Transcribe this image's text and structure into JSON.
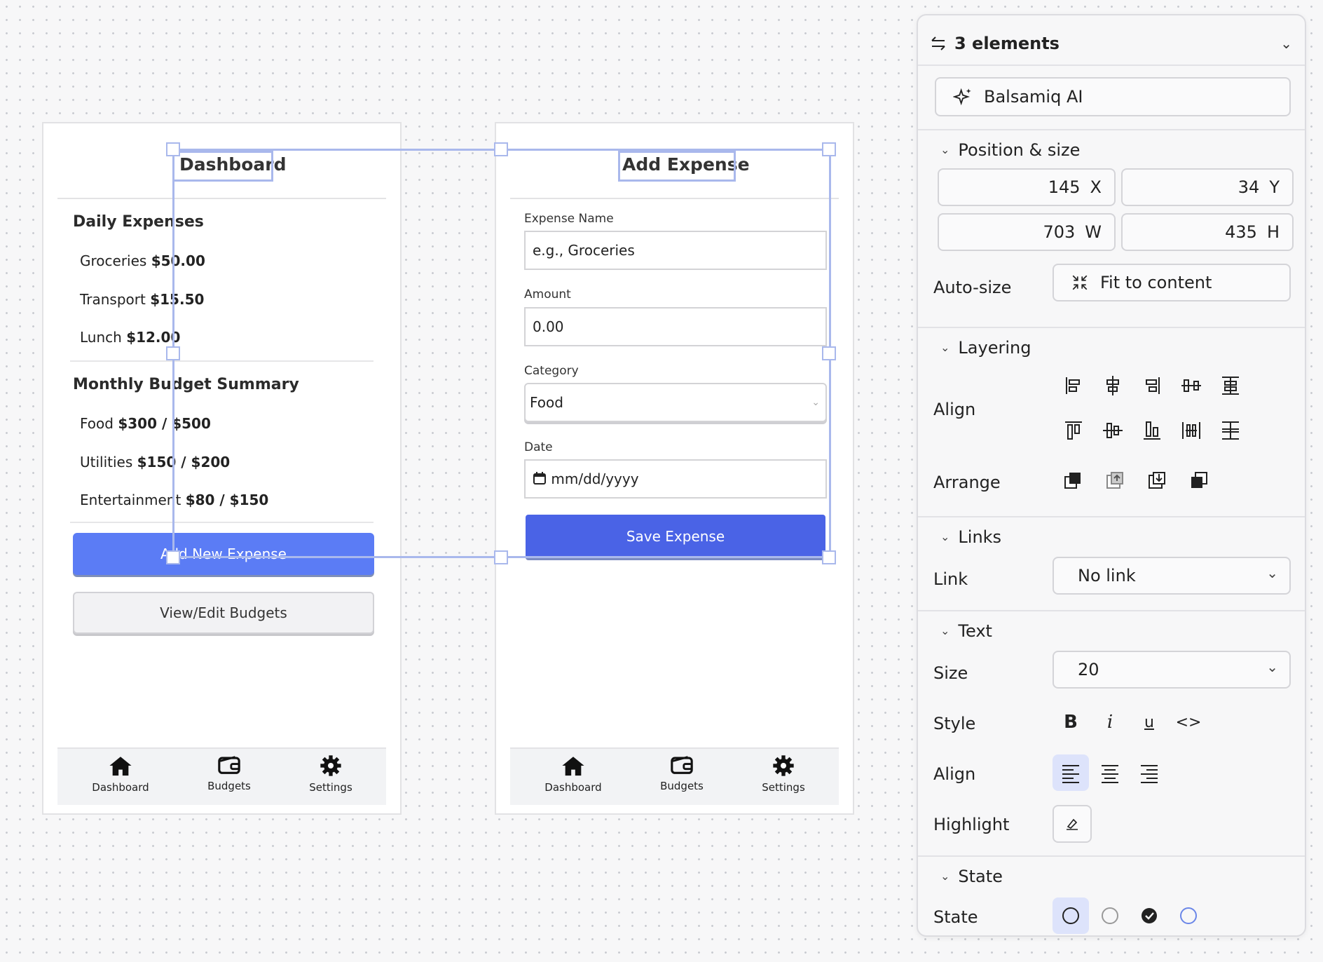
{
  "left_screen": {
    "title": "Dashboard",
    "daily_heading": "Daily Expenses",
    "daily_items": [
      {
        "label": "Groceries",
        "amount": "$50.00"
      },
      {
        "label": "Transport",
        "amount": "$15.50"
      },
      {
        "label": "Lunch",
        "amount": "$12.00"
      }
    ],
    "monthly_heading": "Monthly Budget Summary",
    "monthly_items": [
      {
        "label": "Food",
        "amount": "$300 / $500"
      },
      {
        "label": "Utilities",
        "amount": "$150 / $200"
      },
      {
        "label": "Entertainment",
        "amount": "$80 / $150"
      }
    ],
    "add_button": "Add New Expense",
    "edit_button": "View/Edit Budgets"
  },
  "right_screen": {
    "title": "Add Expense",
    "name_label": "Expense Name",
    "name_placeholder": "e.g., Groceries",
    "amount_label": "Amount",
    "amount_value": "0.00",
    "category_label": "Category",
    "category_value": "Food",
    "date_label": "Date",
    "date_placeholder": "mm/dd/yyyy",
    "save_button": "Save Expense"
  },
  "tabbar": {
    "items": [
      "Dashboard",
      "Budgets",
      "Settings"
    ],
    "icons": [
      "home-icon",
      "wallet-icon",
      "gear-icon"
    ]
  },
  "inspector": {
    "selection_label": "3 elements",
    "ai_button": "Balsamiq AI",
    "position_size_heading": "Position & size",
    "x_value": "145",
    "x_axis": "X",
    "y_value": "34",
    "y_axis": "Y",
    "w_value": "703",
    "w_axis": "W",
    "h_value": "435",
    "h_axis": "H",
    "autosize_label": "Auto-size",
    "fit_button": "Fit to content",
    "layering_heading": "Layering",
    "align_label": "Align",
    "arrange_label": "Arrange",
    "links_heading": "Links",
    "link_label": "Link",
    "link_value": "No link",
    "text_heading": "Text",
    "size_label": "Size",
    "size_value": "20",
    "style_label": "Style",
    "text_align_label": "Align",
    "highlight_label": "Highlight",
    "state_heading": "State",
    "state_label": "State"
  },
  "colors": {
    "primary_button": "#5b7cf5",
    "save_button": "#4a63e6",
    "selection": "#a9b8ec",
    "active_toggle": "#dde3fb"
  }
}
